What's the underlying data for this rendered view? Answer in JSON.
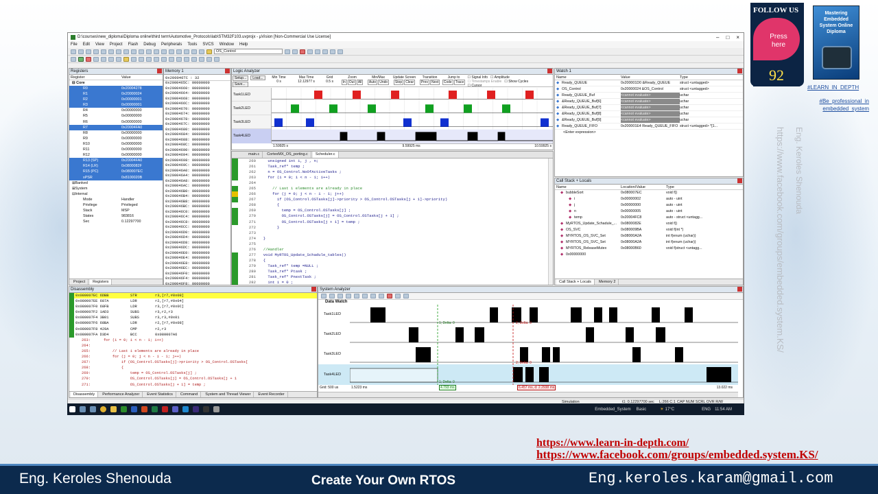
{
  "window": {
    "title": "D:\\courses\\new_diploma\\Diploma online\\third term\\Automotive_Protocols\\lab\\STM32F103.uvprojx - µVision  [Non-Commercial Use License]",
    "menu": [
      "File",
      "Edit",
      "View",
      "Project",
      "Flash",
      "Debug",
      "Peripherals",
      "Tools",
      "SVCS",
      "Window",
      "Help"
    ],
    "toolbar_combo": "OS_Control"
  },
  "registers": {
    "title": "Registers",
    "col_register": "Register",
    "col_value": "Value",
    "core_label": "Core",
    "rows": [
      {
        "name": "R0",
        "value": "0x20004278",
        "selected": true
      },
      {
        "name": "R1",
        "value": "0x20000024",
        "selected": true
      },
      {
        "name": "R2",
        "value": "0x00000001",
        "selected": true
      },
      {
        "name": "R3",
        "value": "0x00000001",
        "selected": true
      },
      {
        "name": "R4",
        "value": "0x00000000",
        "selected": false
      },
      {
        "name": "R5",
        "value": "0x00000000",
        "selected": false
      },
      {
        "name": "R6",
        "value": "0x00000000",
        "selected": false
      },
      {
        "name": "R7",
        "value": "0x20004FA0",
        "selected": true
      },
      {
        "name": "R8",
        "value": "0x00000000",
        "selected": false
      },
      {
        "name": "R9",
        "value": "0x00000000",
        "selected": false
      },
      {
        "name": "R10",
        "value": "0x00000000",
        "selected": false
      },
      {
        "name": "R11",
        "value": "0x00000000",
        "selected": false
      },
      {
        "name": "R12",
        "value": "0x00000000",
        "selected": false
      },
      {
        "name": "R13 (SP)",
        "value": "0x20004FA0",
        "selected": true
      },
      {
        "name": "R14 (LR)",
        "value": "0x0800082F",
        "selected": true
      },
      {
        "name": "R15 (PC)",
        "value": "0x080007EC",
        "selected": true
      },
      {
        "name": "xPSR",
        "value": "0x8100020B",
        "selected": true
      }
    ],
    "groups": [
      "Banked",
      "System",
      "Internal"
    ],
    "internal": [
      {
        "name": "Mode",
        "value": "Handler"
      },
      {
        "name": "Privilege",
        "value": "Privileged"
      },
      {
        "name": "Stack",
        "value": "MSP"
      },
      {
        "name": "States",
        "value": "983816"
      },
      {
        "name": "Sec",
        "value": "0.12297700"
      }
    ],
    "tabs": [
      "Project",
      "Registers"
    ]
  },
  "memory": {
    "title": "Memory 1",
    "address_label": "Address:",
    "address_value": "0x200046TC : 32",
    "rows": [
      "0x2000465C: 00000000",
      "0x20004660: 00000000",
      "0x20004664: 00000000",
      "0x20004668: 00000000",
      "0x2000466C: 00000000",
      "0x20004670: 00000000",
      "0x20004674: 00000000",
      "0x20004678: 00000000",
      "0x2000467C: 00000000",
      "0x20004680: 00000000",
      "0x20004684: 00000000",
      "0x20004688: 00000000",
      "0x2000468C: 00000000",
      "0x20004690: 00000000",
      "0x20004694: 00000000",
      "0x20004698: 00000000",
      "0x2000469C: 00000000",
      "0x200046A0: 00000000",
      "0x200046A4: 00000000",
      "0x200046A8: 00000000",
      "0x200046AC: 00000000",
      "0x200046B0: 00000000",
      "0x200046B4: 00000000",
      "0x200046B8: 00000000",
      "0x200046BC: 00000000",
      "0x200046C0: 00000000",
      "0x200046C4: 00000000",
      "0x200046C8: 00000000",
      "0x200046CC: 00000000",
      "0x200046D0: 00000000",
      "0x200046D4: 00000000",
      "0x200046D8: 00000000",
      "0x200046DC: 00000000",
      "0x200046E0: 00000000",
      "0x200046E4: 00000000",
      "0x200046E8: 00000000",
      "0x200046EC: 00000000",
      "0x200046F0: 00000000",
      "0x200046F4: 00000000",
      "0x200046F8: 00000000"
    ]
  },
  "logic_analyzer": {
    "title": "Logic Analyzer",
    "buttons": [
      "Setup...",
      "Load...",
      "Save..."
    ],
    "groups": [
      "Min Time",
      "Max Time",
      "Grid",
      "Zoom",
      "Min/Max",
      "Update Screen",
      "Transition",
      "Jump to"
    ],
    "zoom_buttons": [
      "In",
      "Out",
      "All"
    ],
    "minmax_buttons": [
      "Auto",
      "Undo"
    ],
    "update_buttons": [
      "Stop",
      "Clear"
    ],
    "transition_buttons": [
      "Prev",
      "Next"
    ],
    "jump_buttons": [
      "Code",
      "Trace"
    ],
    "min_time": "0 s",
    "max_time": "12.12977 s",
    "grid": "0.5 s",
    "checkboxes": [
      "Signal Info",
      "Amplitude",
      "Show Cycles",
      "Cursor",
      "Timestamps Enable"
    ],
    "signals": [
      "Task1LED",
      "Task2LED",
      "Task3LED",
      "Task4LED"
    ],
    "time_left": "1.59925 s",
    "time_mid": "9.59925 ms",
    "time_right": "10.59925 s",
    "colors": {
      "task1": "#e02020",
      "task2": "#10a020",
      "task3": "#1030d0",
      "task4": "#000000"
    }
  },
  "editor": {
    "tabs": [
      "main.c",
      "CortexMX_OS_porting.c",
      "Scheduler.c"
    ],
    "lines": [
      {
        "n": "260",
        "t": "    unsigned int i, j , n;"
      },
      {
        "n": "261",
        "t": "    Task_ref* temp ;"
      },
      {
        "n": "262",
        "t": "    n = OS_Control.NoOfActiveTasks ;"
      },
      {
        "n": "263",
        "t": "    for (i = 0; i < n - 1; i++)"
      },
      {
        "n": "264",
        "t": ""
      },
      {
        "n": "265",
        "t": "      // Last i elements are already in place"
      },
      {
        "n": "266",
        "t": "      for (j = 0; j < n - i - 1; j++)"
      },
      {
        "n": "267",
        "t": "        if (OS_Control.OSTasks[j]->priority > OS_Control.OSTasks[j + 1]->priority)"
      },
      {
        "n": "268",
        "t": "        {"
      },
      {
        "n": "269",
        "t": "          temp = OS_Control.OSTasks[j] ;"
      },
      {
        "n": "270",
        "t": "          OS_Control.OSTasks[j] = OS_Control.OSTasks[j + 1] ;"
      },
      {
        "n": "271",
        "t": "          OS_Control.OSTasks[j + 1] = temp ;"
      },
      {
        "n": "272",
        "t": "        }"
      },
      {
        "n": "273",
        "t": ""
      },
      {
        "n": "274",
        "t": "  }"
      },
      {
        "n": "275",
        "t": ""
      },
      {
        "n": "276",
        "t": "  //Handler"
      },
      {
        "n": "277",
        "t": "  void MyRTOS_Update_Schadule_tables()"
      },
      {
        "n": "278",
        "t": "  {"
      },
      {
        "n": "279",
        "t": "    Task_ref* temp =NULL ;"
      },
      {
        "n": "280",
        "t": "    Task_ref* Ptask ;"
      },
      {
        "n": "281",
        "t": "    Task_ref* PnextTask ;"
      },
      {
        "n": "282",
        "t": "    int i = 0 ;"
      }
    ]
  },
  "watch": {
    "title": "Watch 1",
    "cols": [
      "Name",
      "Value",
      "Type"
    ],
    "rows": [
      {
        "name": "Ready_QUEUE",
        "value": "0x200001D0 &Ready_QUEUE",
        "type": "struct <untagged>"
      },
      {
        "name": "OS_Control",
        "value": "0x20000024 &OS_Control",
        "type": "struct <untagged>"
      },
      {
        "name": "Ready_QUEUE_Buf",
        "value": "<cannot evaluate>",
        "type": "uchar"
      },
      {
        "name": "&Ready_QUEUE_Buf[6]",
        "value": "<cannot evaluate>",
        "type": "uchar"
      },
      {
        "name": "&Ready_QUEUE_Buf[7]",
        "value": "<cannot evaluate>",
        "type": "uchar"
      },
      {
        "name": "&Ready_QUEUE_Buf[8]",
        "value": "<cannot evaluate>",
        "type": "uchar"
      },
      {
        "name": "&Ready_QUEUE_Buf[9]",
        "value": "<cannot evaluate>",
        "type": "uchar"
      },
      {
        "name": "Ready_QUEUE_FIFO",
        "value": "0x200001E4 Ready_QUEUE_FIFO",
        "type": "struct <untagged> *[1..."
      }
    ],
    "enter": "<Enter expression>"
  },
  "callstack": {
    "title": "Call Stack + Locals",
    "cols": [
      "Name",
      "Location/Value",
      "Type"
    ],
    "rows": [
      {
        "name": "bubbleSort",
        "value": "0x080007EC",
        "type": "void f()"
      },
      {
        "name": "i",
        "value": "0x00000002",
        "type": "auto - uint"
      },
      {
        "name": "j",
        "value": "0x00000000",
        "type": "auto - uint"
      },
      {
        "name": "n",
        "value": "0x00000005",
        "type": "auto - uint"
      },
      {
        "name": "temp",
        "value": "0x20004FC8",
        "type": "auto - struct <untagg..."
      },
      {
        "name": "MyRTOS_Update_Schadule_...",
        "value": "0x0800082E",
        "type": "void f()"
      },
      {
        "name": "OS_SVC",
        "value": "0x080009BA",
        "type": "void f(int *)"
      },
      {
        "name": "MYRTOS_OS_SVC_Set",
        "value": "0x08000A2A",
        "type": "int f(enum (uchar))"
      },
      {
        "name": "MYRTOS_OS_SVC_Set",
        "value": "0x08000A2A",
        "type": "int f(enum (uchar))"
      },
      {
        "name": "MYRTOS_ReleaseMutex",
        "value": "0x08000B60",
        "type": "void f(struct <untagg..."
      },
      {
        "name": "0x00000000",
        "value": "",
        "type": ""
      }
    ],
    "tabs": [
      "Call Stack + Locals",
      "Memory 2"
    ]
  },
  "disassembly": {
    "title": "Disassembly",
    "asm": [
      {
        "addr": "0x080007EC 6DBB",
        "op": "STR",
        "arg": "r3,[r7,#0x08]",
        "hl": true
      },
      {
        "addr": "0x080007EE 687A",
        "op": "LDR",
        "arg": "r2,[r7,#0x04]",
        "hl": false
      },
      {
        "addr": "0x080007F0 68FB",
        "op": "LDR",
        "arg": "r3,[r7,#0x0C]",
        "hl": false
      },
      {
        "addr": "0x080007F2 1AD3",
        "op": "SUBS",
        "arg": "r3,r2,r3",
        "hl": false
      },
      {
        "addr": "0x080007F4 3B01",
        "op": "SUBS",
        "arg": "r3,r3,#0x01",
        "hl": false
      },
      {
        "addr": "0x080007F6 68BA",
        "op": "LDR",
        "arg": "r2,[r7,#0x08]",
        "hl": false
      },
      {
        "addr": "0x080007F8 429A",
        "op": "CMP",
        "arg": "r2,r3",
        "hl": false
      },
      {
        "addr": "0x080007FA D3D4",
        "op": "BCC",
        "arg": "0x080007A6",
        "hl": false
      }
    ],
    "src": [
      {
        "n": "263:",
        "t": "    for (i = 0; i < n - 1; i++)"
      },
      {
        "n": "264:",
        "t": ""
      },
      {
        "n": "265:",
        "t": "        // Last i elements are already in place"
      },
      {
        "n": "266:",
        "t": "        for (j = 0; j < n - i - 1; j++)"
      },
      {
        "n": "267:",
        "t": "            if (OS_Control.OSTasks[j]->priority > OS_Control.OSTasks["
      },
      {
        "n": "268:",
        "t": "            {"
      },
      {
        "n": "269:",
        "t": "                temp = OS_Control.OSTasks[j] ;"
      },
      {
        "n": "270:",
        "t": "                OS_Control.OSTasks[j] = OS_Control.OSTasks[j + 1"
      },
      {
        "n": "271:",
        "t": "                OS_Control.OSTasks[j + 1] = temp ;"
      }
    ],
    "tabs": [
      "Disassembly",
      "Performance Analyzer",
      "Event Statistics",
      "Command",
      "System and Thread Viewer",
      "Event Recorder"
    ]
  },
  "system_analyzer": {
    "title": "System Analyzer",
    "header": "Data Watch",
    "signals": [
      "Task1LED",
      "Task2LED",
      "Task3LED",
      "Task4LED"
    ],
    "grid": "Grid: 500 us",
    "t_left": "1.5223 ms",
    "t_right": "13.022 ms",
    "delta1": "1; Delta: 0",
    "delta2": "2; Delta: 0",
    "marker1": "4.793 ms",
    "marker2": "6.457 ms, d: 2.2938 ms"
  },
  "statusbar": {
    "mode": "Simulation",
    "t1": "t1: 0.12297700 sec",
    "pos": "L:266 C:1",
    "caps": "CAP  NUM  SCRL  OVR  R/W"
  },
  "taskbar": {
    "items": [
      "Embedded_System",
      "Basic"
    ],
    "weather": "17°C",
    "lang": "ENG",
    "time": "11:54 AM"
  },
  "slide": {
    "author": "Eng. Keroles Shenouda",
    "title": "Create Your Own RTOS",
    "email": "Eng.keroles.karam@gmail.com",
    "link1": "https://www.learn-in-depth.com/",
    "link2": "https://www.facebook.com/groups/embedded.system.KS/",
    "vertical_link": "https://www.facebook.com/groups/embedded.system.KS/",
    "vertical_name": "Eng. Keroles Shenouda",
    "follow": "FOLLOW US",
    "press": "Press here",
    "page_number": "92",
    "book_title": "Mastering Embedded System Online Diploma",
    "tag1": "#LEARN_IN_DEPTH",
    "tag2": "#Be_professional_in embedded_system"
  }
}
